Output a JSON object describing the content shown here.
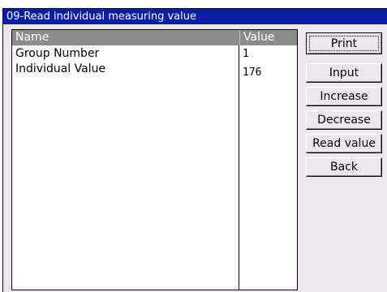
{
  "window": {
    "title": "09-Read individual measuring value"
  },
  "table": {
    "columns": [
      "Name",
      "Value"
    ],
    "rows": [
      {
        "name": "Group Number",
        "value": "1"
      },
      {
        "name": "Individual Value",
        "value": "176"
      }
    ]
  },
  "buttons": {
    "print": "Print",
    "input": "Input",
    "increase": "Increase",
    "decrease": "Decrease",
    "read_value": "Read value",
    "back": "Back"
  },
  "colors": {
    "title_bar": "#0c1fa6",
    "window_bg": "#ede6ef",
    "header_bg": "#8c8c8c"
  }
}
